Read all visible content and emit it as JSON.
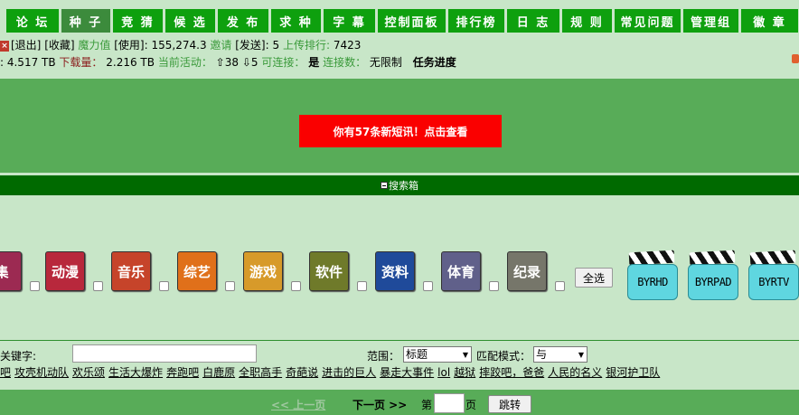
{
  "nav": {
    "items": [
      {
        "label": "论 坛"
      },
      {
        "label": "种 子"
      },
      {
        "label": "竞 猜"
      },
      {
        "label": "候 选"
      },
      {
        "label": "发 布"
      },
      {
        "label": "求 种"
      },
      {
        "label": "字 幕"
      },
      {
        "label": "控制面板"
      },
      {
        "label": "排行榜"
      },
      {
        "label": "日 志"
      },
      {
        "label": "规 则"
      },
      {
        "label": "常见问题"
      },
      {
        "label": "管理组"
      },
      {
        "label": "徽 章"
      }
    ]
  },
  "info": {
    "logout": "[退出]",
    "favorites": "[收藏]",
    "bonus_label": "魔力值",
    "use_label": "[使用]:",
    "bonus_value": "155,274.3",
    "invite_label": "邀请",
    "send_label": "[发送]:",
    "invite_value": "5",
    "upload_rank_label": "上传排行:",
    "upload_rank_value": "7423",
    "uploaded_value": "4.517 TB",
    "downloaded_label": "下载量：",
    "downloaded_value": "2.216 TB",
    "active_label": "当前活动：",
    "seeding": "38",
    "leeching": "5",
    "connectable_label": "可连接：",
    "connectable_value": "是",
    "connections_label": "连接数：",
    "connections_value": "无限制",
    "task_progress": "任务进度"
  },
  "news": {
    "button": "你有57条新短讯！点击查看"
  },
  "search_box": {
    "title": "搜索箱"
  },
  "categories": [
    {
      "label": "集",
      "color": "#9c2a52"
    },
    {
      "label": "动漫",
      "color": "#b8283c"
    },
    {
      "label": "音乐",
      "color": "#c6442a"
    },
    {
      "label": "综艺",
      "color": "#e0701a"
    },
    {
      "label": "游戏",
      "color": "#d79a2a"
    },
    {
      "label": "软件",
      "color": "#6f7a2a"
    },
    {
      "label": "资料",
      "color": "#1f4a9a"
    },
    {
      "label": "体育",
      "color": "#60608a"
    },
    {
      "label": "纪录",
      "color": "#76766a"
    }
  ],
  "select_all": "全选",
  "clapboards": [
    {
      "label": "BYRHD"
    },
    {
      "label": "BYRPAD"
    },
    {
      "label": "BYRTV"
    }
  ],
  "keyword": {
    "label": "关键字:",
    "range_label": "范围：",
    "range_value": "标题",
    "mode_label": "匹配模式：",
    "mode_value": "与"
  },
  "hot_links": [
    "吧",
    "攻壳机动队",
    "欢乐颂",
    "生活大爆炸",
    "奔跑吧",
    "白鹿原",
    "全职高手",
    "奇葩说",
    "进击的巨人",
    "暴走大事件",
    "lol",
    "越狱",
    "摔跤吧，爸爸",
    "人民的名义",
    "银河护卫队"
  ],
  "pager": {
    "prev": "<< 上一页",
    "next": "下一页 >>",
    "page_pre": "第",
    "page_suf": "页",
    "jump": "跳转"
  }
}
